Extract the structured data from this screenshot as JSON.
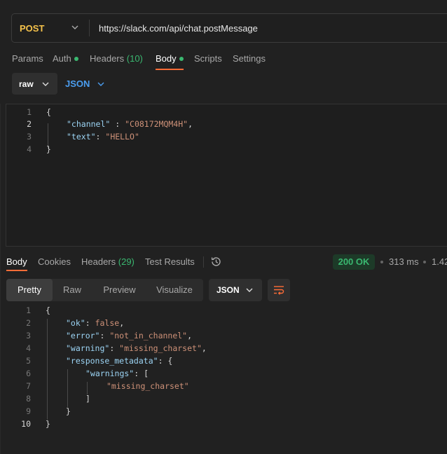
{
  "request": {
    "method": "POST",
    "url": "https://slack.com/api/chat.postMessage"
  },
  "request_tabs": [
    {
      "label": "Params"
    },
    {
      "label": "Auth"
    },
    {
      "label": "Headers",
      "count": "(10)"
    },
    {
      "label": "Body"
    },
    {
      "label": "Scripts"
    },
    {
      "label": "Settings"
    }
  ],
  "body_mode": {
    "type": "raw",
    "format": "JSON"
  },
  "request_code": [
    {
      "n": "1",
      "text": "{"
    },
    {
      "n": "2",
      "key": "\"channel\"",
      "sep": " : ",
      "value": "\"C08172MQM4H\"",
      "tail": ","
    },
    {
      "n": "3",
      "key": "\"text\"",
      "sep": ": ",
      "value": "\"HELLO\"",
      "tail": ""
    },
    {
      "n": "4",
      "text": "}"
    }
  ],
  "response_tabs": [
    {
      "label": "Body"
    },
    {
      "label": "Cookies"
    },
    {
      "label": "Headers",
      "count": "(29)"
    },
    {
      "label": "Test Results"
    }
  ],
  "response_meta": {
    "status": "200 OK",
    "time": "313 ms",
    "size": "1.42"
  },
  "view_modes": [
    "Pretty",
    "Raw",
    "Preview",
    "Visualize"
  ],
  "response_format": "JSON",
  "response_code": [
    {
      "n": "1",
      "text": "{"
    },
    {
      "n": "2",
      "key": "\"ok\"",
      "sep": ": ",
      "lit": "false",
      "tail": ","
    },
    {
      "n": "3",
      "key": "\"error\"",
      "sep": ": ",
      "value": "\"not_in_channel\"",
      "tail": ","
    },
    {
      "n": "4",
      "key": "\"warning\"",
      "sep": ": ",
      "value": "\"missing_charset\"",
      "tail": ","
    },
    {
      "n": "5",
      "key": "\"response_metadata\"",
      "sep": ": ",
      "tail": "{"
    },
    {
      "n": "6",
      "key": "\"warnings\"",
      "sep": ": ",
      "tail": "["
    },
    {
      "n": "7",
      "value": "\"missing_charset\""
    },
    {
      "n": "8",
      "text": "]"
    },
    {
      "n": "9",
      "text": "}"
    },
    {
      "n": "10",
      "text": "}"
    }
  ],
  "colors": {
    "method": "#f5c24b",
    "accent_underline": "#ff6c37",
    "success": "#3ab870",
    "json_key": "#9cd4f4",
    "json_string": "#ce9178",
    "format_link": "#4b9ef0"
  }
}
